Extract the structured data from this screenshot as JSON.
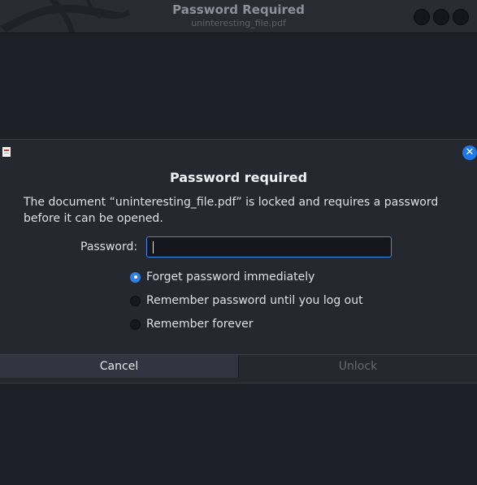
{
  "window": {
    "title": "Password Required",
    "subtitle": "uninteresting_file.pdf"
  },
  "dialog": {
    "heading": "Password required",
    "message": "The document “uninteresting_file.pdf” is locked and requires a password before it can be opened.",
    "password_label": "Password:",
    "password_value": "",
    "options": [
      {
        "label": "Forget password immediately",
        "selected": true
      },
      {
        "label": "Remember password until you log out",
        "selected": false
      },
      {
        "label": "Remember forever",
        "selected": false
      }
    ],
    "cancel_label": "Cancel",
    "unlock_label": "Unlock"
  },
  "colors": {
    "accent": "#1d79e9",
    "background": "#1e2029",
    "dialog_background": "#26282f"
  },
  "icons": [
    "dragon-logo-icon",
    "document-icon",
    "close-icon"
  ]
}
